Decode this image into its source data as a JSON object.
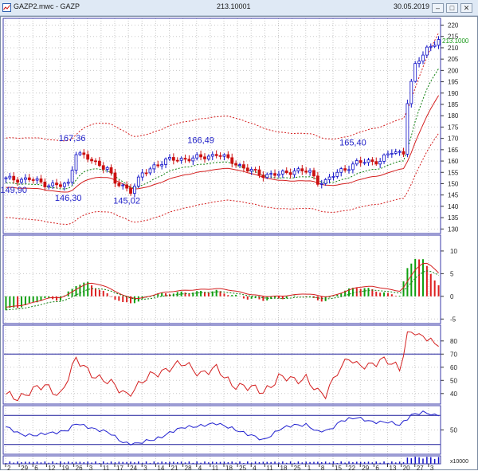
{
  "titlebar": {
    "title": "GAZP2.mwc - GAZP",
    "price": "213.10001",
    "date": "30.05.2019",
    "buttons": {
      "minimize": "–",
      "restore": "□",
      "close": "✕"
    },
    "icon": "chart-window-icon"
  },
  "colors": {
    "up": "#1010c8",
    "down": "#cc1111",
    "ma": "#d42020",
    "bands": "#d42020",
    "hist_up": "#10a010",
    "hist_down": "#dd2020",
    "blue_line": "#2020d0",
    "grid": "#c8c8c8",
    "axis_line": "#1a1a9a",
    "last_price": "#1b9a1b"
  },
  "chart_data": [
    {
      "type": "candlestick",
      "panel": "price",
      "y_ticks": [
        "130",
        "135",
        "140",
        "145",
        "150",
        "155",
        "160",
        "165",
        "170",
        "175",
        "180",
        "185",
        "190",
        "195",
        "200",
        "205",
        "210",
        "215",
        "220"
      ],
      "ylim": [
        128,
        223
      ],
      "last_price_label": "213.1000",
      "x_count": 112,
      "anchors_close": [
        [
          0,
          152
        ],
        [
          6,
          152
        ],
        [
          10,
          150
        ],
        [
          14,
          149
        ],
        [
          16,
          150
        ],
        [
          18,
          164
        ],
        [
          22,
          160
        ],
        [
          26,
          157
        ],
        [
          28,
          150
        ],
        [
          30,
          149
        ],
        [
          32,
          147
        ],
        [
          35,
          154
        ],
        [
          38,
          158
        ],
        [
          41,
          160
        ],
        [
          44,
          161
        ],
        [
          48,
          161
        ],
        [
          51,
          162
        ],
        [
          54,
          163
        ],
        [
          58,
          160
        ],
        [
          62,
          156
        ],
        [
          66,
          154
        ],
        [
          70,
          154
        ],
        [
          74,
          156
        ],
        [
          78,
          155
        ],
        [
          80,
          151
        ],
        [
          82,
          151
        ],
        [
          86,
          156
        ],
        [
          90,
          159
        ],
        [
          93,
          160
        ],
        [
          96,
          160
        ],
        [
          99,
          164
        ],
        [
          102,
          164
        ],
        [
          103,
          186
        ],
        [
          105,
          202
        ],
        [
          108,
          210
        ],
        [
          111,
          213
        ]
      ],
      "annotations": [
        {
          "text": "149,90",
          "i": 2,
          "value": 149.9,
          "pos": "below"
        },
        {
          "text": "167,36",
          "i": 17,
          "value": 167.36,
          "pos": "above"
        },
        {
          "text": "146,30",
          "i": 16,
          "value": 146.3,
          "pos": "below"
        },
        {
          "text": "145,02",
          "i": 31,
          "value": 145.02,
          "pos": "below"
        },
        {
          "text": "166,49",
          "i": 50,
          "value": 166.49,
          "pos": "above"
        },
        {
          "text": "165,40",
          "i": 89,
          "value": 165.4,
          "pos": "above"
        }
      ]
    },
    {
      "type": "bar",
      "panel": "oscillator",
      "y_ticks": [
        "-5",
        "0",
        "5",
        "10"
      ],
      "ylim": [
        -6,
        13.5
      ],
      "anchors": [
        [
          0,
          -3
        ],
        [
          5,
          -2
        ],
        [
          10,
          -0.5
        ],
        [
          14,
          -0.8
        ],
        [
          18,
          2.5
        ],
        [
          21,
          3
        ],
        [
          26,
          0.5
        ],
        [
          30,
          -1.5
        ],
        [
          34,
          -1.2
        ],
        [
          38,
          0.5
        ],
        [
          44,
          0.8
        ],
        [
          50,
          1
        ],
        [
          54,
          1.2
        ],
        [
          58,
          0.3
        ],
        [
          62,
          -0.5
        ],
        [
          66,
          -0.8
        ],
        [
          70,
          -0.5
        ],
        [
          76,
          0.2
        ],
        [
          80,
          -0.8
        ],
        [
          82,
          -1
        ],
        [
          86,
          1
        ],
        [
          90,
          2
        ],
        [
          94,
          1.5
        ],
        [
          98,
          0.5
        ],
        [
          101,
          0.3
        ],
        [
          103,
          6
        ],
        [
          105,
          8.5
        ],
        [
          107,
          8
        ],
        [
          109,
          5
        ],
        [
          111,
          2.5
        ]
      ]
    },
    {
      "type": "line",
      "panel": "rsi",
      "y_ticks": [
        "40",
        "50",
        "60",
        "70",
        "80"
      ],
      "ylim": [
        32,
        92
      ],
      "levels": [
        70
      ],
      "anchors": [
        [
          0,
          38
        ],
        [
          3,
          37
        ],
        [
          6,
          42
        ],
        [
          10,
          45
        ],
        [
          14,
          40
        ],
        [
          18,
          65
        ],
        [
          21,
          58
        ],
        [
          24,
          52
        ],
        [
          28,
          45
        ],
        [
          31,
          40
        ],
        [
          34,
          46
        ],
        [
          38,
          55
        ],
        [
          42,
          60
        ],
        [
          46,
          62
        ],
        [
          50,
          56
        ],
        [
          54,
          58
        ],
        [
          58,
          48
        ],
        [
          62,
          44
        ],
        [
          66,
          42
        ],
        [
          70,
          52
        ],
        [
          74,
          50
        ],
        [
          77,
          53
        ],
        [
          80,
          40
        ],
        [
          82,
          38
        ],
        [
          85,
          58
        ],
        [
          88,
          67
        ],
        [
          90,
          60
        ],
        [
          93,
          62
        ],
        [
          96,
          66
        ],
        [
          99,
          62
        ],
        [
          101,
          58
        ],
        [
          103,
          86
        ],
        [
          105,
          88
        ],
        [
          107,
          80
        ],
        [
          109,
          82
        ],
        [
          110,
          75
        ],
        [
          111,
          78
        ]
      ]
    },
    {
      "type": "line",
      "panel": "oscillator-2",
      "y_ticks": [
        "50"
      ],
      "ylim": [
        0,
        100
      ],
      "levels": [
        20,
        80
      ],
      "anchors": [
        [
          0,
          55
        ],
        [
          4,
          42
        ],
        [
          8,
          38
        ],
        [
          12,
          45
        ],
        [
          16,
          50
        ],
        [
          18,
          62
        ],
        [
          22,
          55
        ],
        [
          26,
          45
        ],
        [
          30,
          25
        ],
        [
          34,
          22
        ],
        [
          38,
          30
        ],
        [
          42,
          45
        ],
        [
          46,
          55
        ],
        [
          50,
          60
        ],
        [
          54,
          62
        ],
        [
          58,
          55
        ],
        [
          62,
          40
        ],
        [
          66,
          30
        ],
        [
          70,
          50
        ],
        [
          74,
          60
        ],
        [
          77,
          62
        ],
        [
          80,
          45
        ],
        [
          83,
          50
        ],
        [
          86,
          70
        ],
        [
          90,
          74
        ],
        [
          94,
          68
        ],
        [
          98,
          65
        ],
        [
          101,
          60
        ],
        [
          104,
          82
        ],
        [
          107,
          85
        ],
        [
          110,
          80
        ],
        [
          111,
          82
        ]
      ]
    },
    {
      "type": "bar",
      "panel": "volume",
      "scale_label": "x10000",
      "x_tick_labels": [
        "2",
        "29",
        "6",
        "12",
        "19",
        "26",
        "3",
        "11",
        "17",
        "24",
        "3",
        "14",
        "21",
        "28",
        "4",
        "11",
        "18",
        "25",
        "4",
        "11",
        "18",
        "25",
        "1",
        "8",
        "15",
        "22",
        "29",
        "6",
        "13",
        "20",
        "27",
        "3"
      ]
    }
  ]
}
